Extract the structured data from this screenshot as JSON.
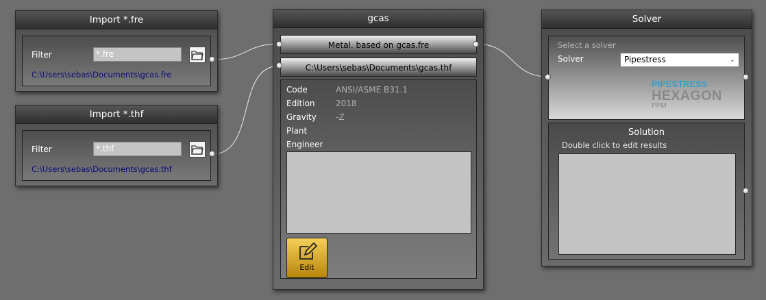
{
  "import_fre": {
    "title": "Import *.fre",
    "filter_label": "Filter",
    "filter_value": "*.fre",
    "path": "C:\\Users\\sebas\\Documents\\gcas.fre",
    "browse_icon": "folder-open-icon"
  },
  "import_thf": {
    "title": "Import *.thf",
    "filter_label": "Filter",
    "filter_value": "*.thf",
    "path": "C:\\Users\\sebas\\Documents\\gcas.thf",
    "browse_icon": "folder-open-icon"
  },
  "gcas": {
    "title": "gcas",
    "input1": "Metal. based on gcas.fre",
    "input2": "C:\\Users\\sebas\\Documents\\gcas.thf",
    "props": [
      {
        "label": "Code",
        "value": "ANSI/ASME B31.1"
      },
      {
        "label": "Edition",
        "value": "2018"
      },
      {
        "label": "Gravity",
        "value": "-Z"
      },
      {
        "label": "Plant",
        "value": ""
      },
      {
        "label": "Engineer",
        "value": ""
      }
    ],
    "edit_label": "Edit",
    "edit_icon": "edit-pencil-icon"
  },
  "solver": {
    "title": "Solver",
    "hint": "Select a solver",
    "solver_label": "Solver",
    "solver_value": "Pipestress",
    "logo_line1": "PIPESTRESS",
    "logo_line2": "HEXAGON",
    "logo_line3": "PPM",
    "solution_title": "Solution",
    "solution_hint": "Double click to edit results"
  },
  "colors": {
    "background": "#6e6e6e",
    "path_text": "#0a0a7a",
    "logo_blue": "#3a9ec6",
    "logo_gray": "#8a8a8a",
    "edit_gold": "#d9a520"
  }
}
